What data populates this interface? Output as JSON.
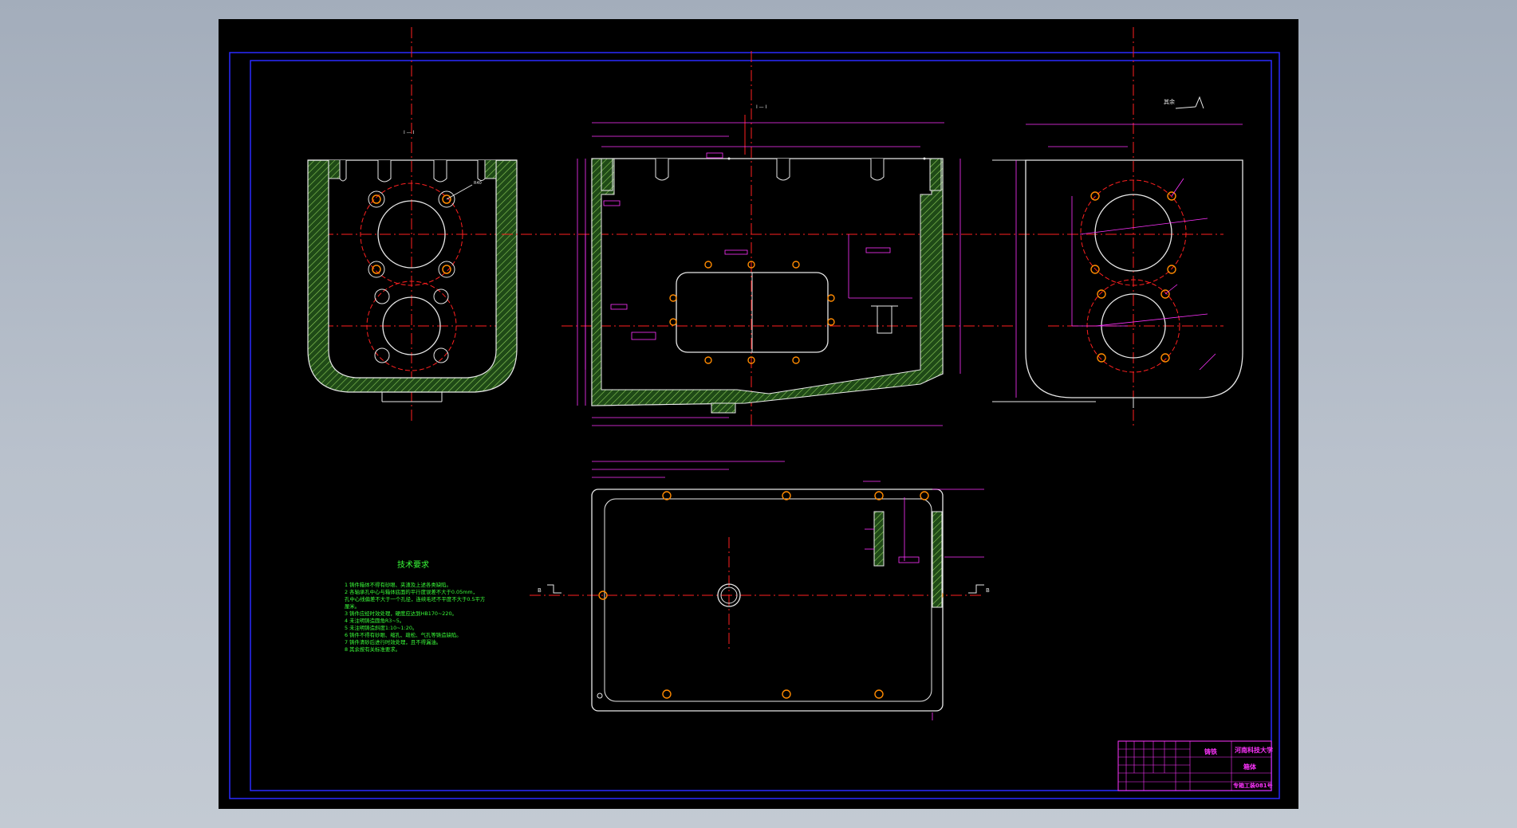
{
  "drawing": {
    "section_label_top": "I — I",
    "section_label_left": "I — I",
    "section_label_bottom_left": "B",
    "section_label_bottom_right": "B",
    "roughness_note": "其余",
    "dim_left_view_radius": "R40"
  },
  "tech_requirements": {
    "title": "技术要求",
    "lines": [
      "1 铸件箱体不得有砂眼、夹渣及上述各类缺陷。",
      "2 各轴承孔中心与箱体底面的平行度误差不大于0.05mm，",
      "  孔中心线偏差不大于一个孔径，连续毛坯不平度不大于0.5平方",
      "  厘米。",
      "3 铸件应经时效处理，硬度应达到HB170~220。",
      "4 未注明铸造圆角R3~5。",
      "5 未注明铸造斜度1:10~1:20。",
      "6 铸件不得有砂眼、缩孔、疏松、气孔等铸造缺陷。",
      "7 铸件清砂后进行时效处理，且不得漏油。",
      "8 其余按有关标准要求。"
    ]
  },
  "title_block": {
    "material": "铸铁",
    "school": "河南科技大学",
    "part_name": "箱体",
    "drawing_number": "专箱工装081号"
  },
  "colors": {
    "background": "#000000",
    "frame": "#2b2bff",
    "outline": "#e8e8e8",
    "centerline": "#ff2020",
    "dimension": "#ff33ff",
    "section_fill": "#2e5a1e",
    "text_note": "#3aff3a"
  }
}
